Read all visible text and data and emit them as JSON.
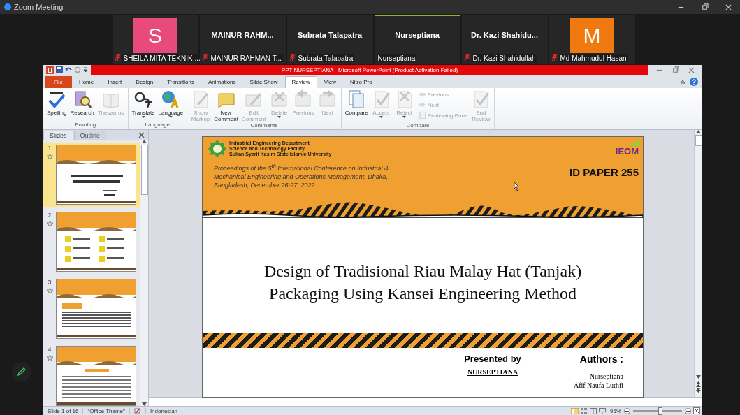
{
  "window": {
    "title": "Zoom Meeting"
  },
  "participants": [
    {
      "kind": "avatar",
      "avatar_letter": "S",
      "color": "#e94a7c",
      "label": "SHEILA MITA TEKNIK ...",
      "muted": true,
      "speaking": false
    },
    {
      "kind": "name",
      "display_name": "MAINUR RAHM...",
      "label": "MAINUR RAHMAN T...",
      "muted": true,
      "speaking": false
    },
    {
      "kind": "name",
      "display_name": "Subrata Talapatra",
      "label": "Subrata Talapatra",
      "muted": true,
      "speaking": false
    },
    {
      "kind": "name",
      "display_name": "Nurseptiana",
      "label": "Nurseptiana",
      "muted": false,
      "speaking": true
    },
    {
      "kind": "name",
      "display_name": "Dr. Kazi Shahidu...",
      "label": "Dr. Kazi Shahidullah",
      "muted": true,
      "speaking": false
    },
    {
      "kind": "avatar",
      "avatar_letter": "M",
      "color": "#f07a10",
      "label": "Md Mahmudul Hasan",
      "muted": true,
      "speaking": false
    }
  ],
  "powerpoint": {
    "title": "PPT NURSEPTIANA  -  Microsoft PowerPoint (Product Activation Failed)",
    "tabs": [
      {
        "label": "File",
        "kind": "file",
        "selected": false
      },
      {
        "label": "Home",
        "kind": "tab",
        "selected": false
      },
      {
        "label": "Insert",
        "kind": "tab",
        "selected": false
      },
      {
        "label": "Design",
        "kind": "tab",
        "selected": false
      },
      {
        "label": "Transitions",
        "kind": "tab",
        "selected": false
      },
      {
        "label": "Animations",
        "kind": "tab",
        "selected": false
      },
      {
        "label": "Slide Show",
        "kind": "tab",
        "selected": false
      },
      {
        "label": "Review",
        "kind": "tab",
        "selected": true
      },
      {
        "label": "View",
        "kind": "tab",
        "selected": false
      },
      {
        "label": "Nitro Pro",
        "kind": "tab",
        "selected": false
      }
    ],
    "ribbon_groups": [
      {
        "label": "Proofing",
        "buttons": [
          {
            "kind": "large",
            "lines": [
              "Spelling"
            ],
            "disabled": false,
            "dropdown": false
          },
          {
            "kind": "large",
            "lines": [
              "Research"
            ],
            "disabled": false,
            "dropdown": false
          },
          {
            "kind": "large",
            "lines": [
              "Thesaurus"
            ],
            "disabled": true,
            "dropdown": false
          }
        ]
      },
      {
        "label": "Language",
        "buttons": [
          {
            "kind": "large",
            "lines": [
              "Translate"
            ],
            "disabled": false,
            "dropdown": true
          },
          {
            "kind": "large",
            "lines": [
              "Language"
            ],
            "disabled": false,
            "dropdown": true
          }
        ]
      },
      {
        "label": "Comments",
        "buttons": [
          {
            "kind": "large",
            "lines": [
              "Show",
              "Markup"
            ],
            "disabled": true,
            "dropdown": false
          },
          {
            "kind": "large",
            "lines": [
              "New",
              "Comment"
            ],
            "disabled": false,
            "dropdown": false
          },
          {
            "kind": "large",
            "lines": [
              "Edit",
              "Comment"
            ],
            "disabled": true,
            "dropdown": false
          },
          {
            "kind": "large",
            "lines": [
              "Delete"
            ],
            "disabled": true,
            "dropdown": true
          },
          {
            "kind": "large",
            "lines": [
              "Previous"
            ],
            "disabled": true,
            "dropdown": false
          },
          {
            "kind": "large",
            "lines": [
              "Next"
            ],
            "disabled": true,
            "dropdown": false
          }
        ]
      },
      {
        "label": "Compare",
        "buttons": [
          {
            "kind": "large",
            "lines": [
              "Compare"
            ],
            "disabled": false,
            "dropdown": false
          },
          {
            "kind": "large",
            "lines": [
              "Accept"
            ],
            "disabled": true,
            "dropdown": true
          },
          {
            "kind": "large",
            "lines": [
              "Reject"
            ],
            "disabled": true,
            "dropdown": true
          },
          {
            "kind": "small",
            "lines": [
              "Previous"
            ],
            "disabled": true,
            "dropdown": false
          },
          {
            "kind": "small",
            "lines": [
              "Next"
            ],
            "disabled": true,
            "dropdown": false
          },
          {
            "kind": "small",
            "lines": [
              "Reviewing Pane"
            ],
            "disabled": true,
            "dropdown": false
          },
          {
            "kind": "large",
            "lines": [
              "End",
              "Review"
            ],
            "disabled": true,
            "dropdown": false
          }
        ]
      }
    ],
    "slides_panel": {
      "tabs": [
        {
          "label": "Slides",
          "selected": true
        },
        {
          "label": "Outline",
          "selected": false
        }
      ],
      "thumbnails": [
        {
          "number": "1",
          "selected": true
        },
        {
          "number": "2",
          "selected": false
        },
        {
          "number": "3",
          "selected": false
        },
        {
          "number": "4",
          "selected": false
        }
      ]
    },
    "slide": {
      "header_lines": [
        "Industrial Engineering Department",
        "Science and Technology Faculty",
        "Sultan Syarif Kasim State Islamic University"
      ],
      "logo_text": "IEOM",
      "paper_id": "ID PAPER 255",
      "proceedings": "Proceedings of the 5$^{th}$ International Conference on Industrial & Mechanical Engineering and Operations Management, Dhaka, Bangladesh, December 26-27, 2022",
      "title_lines": [
        "Design of Tradisional Riau Malay Hat (Tanjak)",
        "Packaging Using Kansei Engineering Method"
      ],
      "presented_by_label": "Presented by",
      "presenter": "NURSEPTIANA",
      "authors_label": "Authors :",
      "authors": [
        "Nurseptiana",
        "Afif Naufa Luthfi"
      ]
    },
    "status_bar": {
      "slide_info": "Slide 1 of 16",
      "theme": "\"Office Theme\"",
      "language": "Indonesian",
      "zoom": "95%",
      "zoom_slider": {
        "level": 0.55
      }
    }
  }
}
